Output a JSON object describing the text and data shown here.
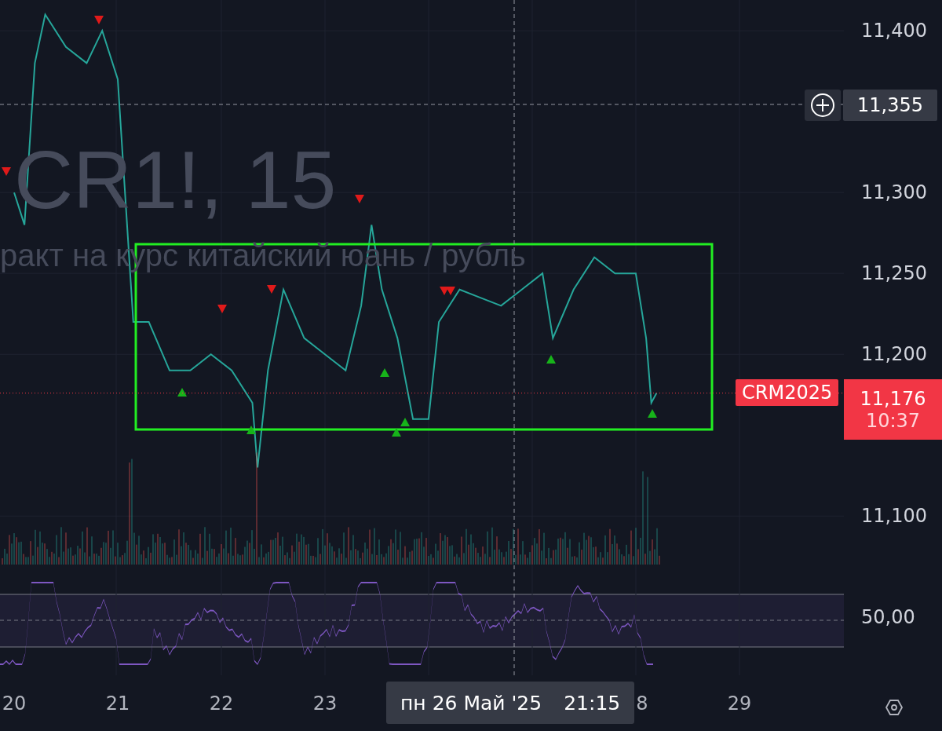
{
  "watermark": {
    "symbol": "CR1!, 15",
    "description": "ракт на курс китайский юань / рубль"
  },
  "price_chart": {
    "chart_data": {
      "type": "line",
      "x": [
        20,
        20.1,
        20.2,
        20.3,
        20.5,
        20.7,
        20.85,
        21.0,
        21.1,
        21.15,
        21.3,
        21.5,
        21.7,
        21.9,
        22.1,
        22.3,
        22.35,
        22.45,
        22.6,
        22.8,
        23.0,
        23.2,
        23.35,
        23.45,
        23.55,
        23.7,
        23.85,
        24.0,
        24.1,
        24.3,
        24.5,
        24.7,
        24.9,
        25.1,
        25.2,
        25.4,
        25.6,
        25.8,
        26.0,
        26.1,
        26.15,
        26.2
      ],
      "series": [
        {
          "color": "#26a69a",
          "values": [
            11300,
            11280,
            11380,
            11410,
            11390,
            11380,
            11400,
            11370,
            11270,
            11220,
            11220,
            11190,
            11190,
            11200,
            11190,
            11170,
            11130,
            11190,
            11240,
            11210,
            11200,
            11190,
            11230,
            11280,
            11240,
            11210,
            11160,
            11160,
            11220,
            11240,
            11235,
            11230,
            11240,
            11250,
            11210,
            11240,
            11260,
            11250,
            11250,
            11210,
            11170,
            11176
          ]
        }
      ],
      "xlim": [
        19.864,
        28.008
      ],
      "ylim": [
        11055,
        11419
      ],
      "grid": true,
      "xticks": [
        {
          "value": 20,
          "label": "20"
        },
        {
          "value": 21,
          "label": "21"
        },
        {
          "value": 22,
          "label": "22"
        },
        {
          "value": 23,
          "label": "23"
        }
      ],
      "yticks": [
        {
          "value": 11400,
          "label": "11,400"
        },
        {
          "value": 11300,
          "label": "11,300"
        },
        {
          "value": 11250,
          "label": "11,250"
        },
        {
          "value": 11200,
          "label": "11,200"
        },
        {
          "value": 11100,
          "label": "11,100"
        }
      ]
    }
  },
  "time_axis_extra": [
    "8",
    "29"
  ],
  "crosshair": {
    "price": "11,355",
    "date": "пн 26 Май '25",
    "time": "21:15"
  },
  "last_price": {
    "symbol": "CRM2025",
    "price": "11,176",
    "countdown": "10:37"
  },
  "rsi": {
    "tick": "50,00"
  }
}
